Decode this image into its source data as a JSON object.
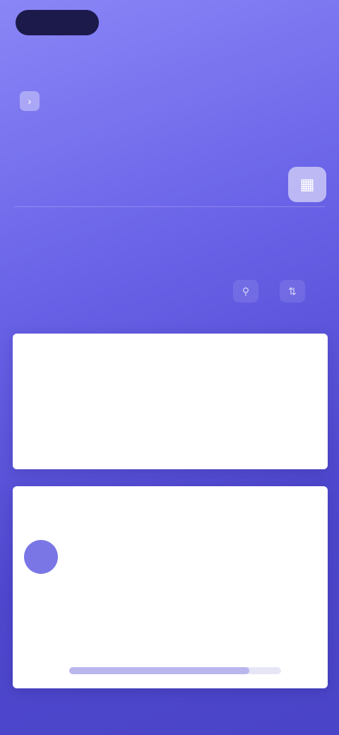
{
  "topbar": {
    "brand": "",
    "right_label": ""
  },
  "hero": {
    "title": "",
    "subtitle": "",
    "subtitle_icon": "arrow-icon"
  },
  "side_action": {
    "icon": "grid-icon"
  },
  "filter": {
    "label": "",
    "chip_a_icon": "filter-icon",
    "chip_b_icon": "sort-icon"
  },
  "card1": {
    "title": "",
    "meta": "",
    "body": ""
  },
  "card2": {
    "title": "",
    "link": "",
    "avatar_initials": "",
    "stats": [
      "",
      "",
      ""
    ],
    "row1": "",
    "row2": "",
    "progress": 0.85
  },
  "colors": {
    "bg_top": "#8a86f6",
    "bg_bottom": "#4a44c8",
    "brand_pill": "#1c1a4a",
    "avatar": "#7a76e6"
  }
}
